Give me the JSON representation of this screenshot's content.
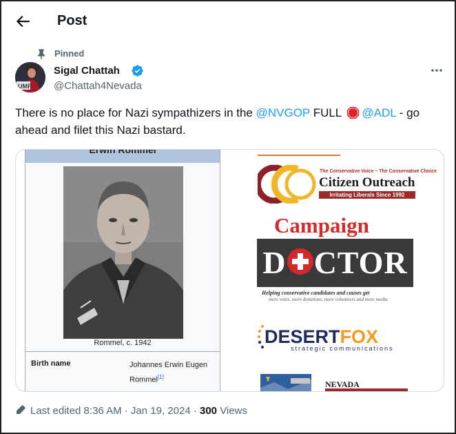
{
  "header": {
    "title": "Post",
    "back_icon": "arrow-left-icon"
  },
  "pinned": {
    "label": "Pinned",
    "icon": "pin-icon"
  },
  "author": {
    "name": "Sigal Chattah",
    "handle": "@Chattah4Nevada",
    "verified_icon": "verified-badge-icon",
    "avatar_text": "UMP",
    "more_icon": "more-horizontal-icon"
  },
  "tweet": {
    "text_1": "There is no place for Nazi sympathizers in the ",
    "mention_1": "@NVGOP",
    "text_2": " FULL ",
    "stop_icon": "stop-sign-icon",
    "mention_2": "@ADL",
    "text_3": " - go ahead and filet this Nazi bastard."
  },
  "media": {
    "left": {
      "header": "Erwin Rommel",
      "caption": "Rommel, c. 1942",
      "birth_label": "Birth name",
      "birth_value": "Johannes Erwin Eugen Rommel",
      "ref": "[1]"
    },
    "right": {
      "co_tagline": "The Conservative Voice – The Conservative Choice",
      "co_name": "Citizen Outreach",
      "co_bar": "Irritating Liberals Since 1992",
      "campaign": "Campaign",
      "doctor_d": "D",
      "doctor_rest": "CTOR",
      "doctor_tag1": "Helping conservative candidates and causes get",
      "doctor_tag2": "more votes, more donations, more volunteers and more media",
      "fox_desert": "DESERT",
      "fox_fox": "FOX",
      "fox_tag": "strategic communications",
      "nv_title": "NEVADA"
    }
  },
  "footer": {
    "edit_icon": "pencil-icon",
    "edited": "Last edited 8:36 AM · Jan 19, 2024 · ",
    "views_count": "300",
    "views_label": " Views"
  },
  "colors": {
    "accent": "#1d9bf0",
    "text": "#0f1419",
    "muted": "#536471",
    "border": "#cfd9de"
  }
}
